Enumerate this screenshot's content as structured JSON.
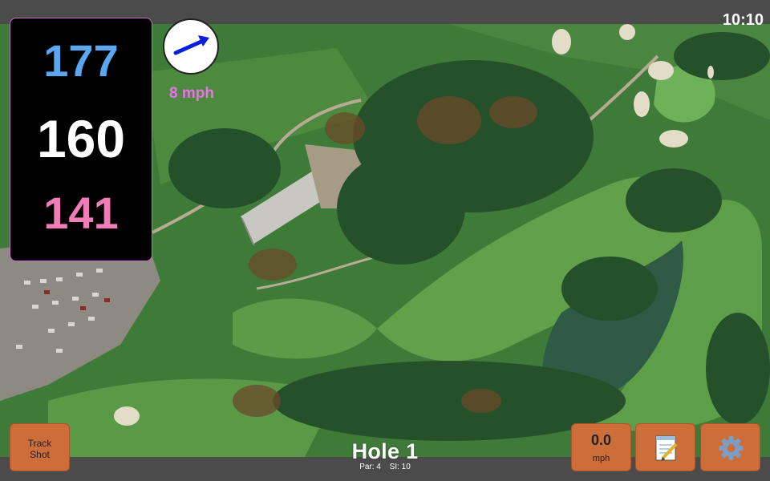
{
  "status": {
    "time": "10:10"
  },
  "distances": {
    "back": "177",
    "middle": "160",
    "front": "141"
  },
  "wind": {
    "speed": "8 mph",
    "arrow_icon": "wind-direction-arrow-icon"
  },
  "hole": {
    "title": "Hole 1",
    "par": "Par: 4",
    "si": "SI: 10"
  },
  "buttons": {
    "track_shot_line1": "Track",
    "track_shot_line2": "Shot",
    "speed_value": "0.0",
    "speed_unit": "mph",
    "notes_icon": "notepad-icon",
    "settings_icon": "gear-icon"
  },
  "colors": {
    "back_distance": "#5aa7f2",
    "middle_distance": "#ffffff",
    "front_distance": "#f07db8",
    "wind_text": "#e874e8",
    "button": "#cd6d3a"
  }
}
